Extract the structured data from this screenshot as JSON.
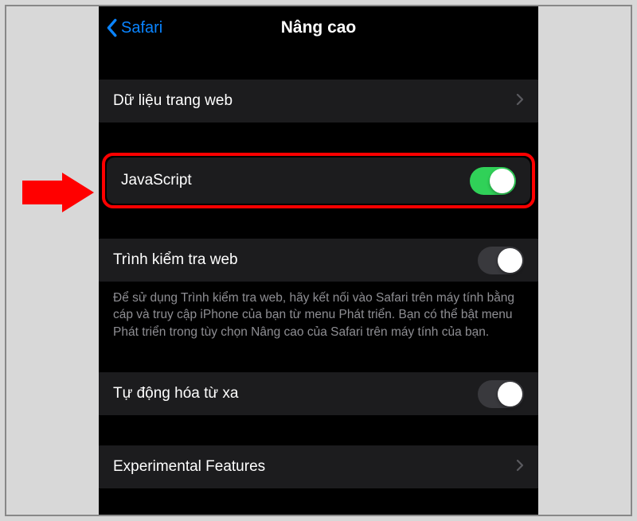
{
  "nav": {
    "back_label": "Safari",
    "title": "Nâng cao"
  },
  "rows": {
    "website_data": "Dữ liệu trang web",
    "javascript": "JavaScript",
    "web_inspector": "Trình kiểm tra web",
    "remote_automation": "Tự động hóa từ xa",
    "experimental_features": "Experimental Features"
  },
  "footer": {
    "web_inspector_help": "Để sử dụng Trình kiểm tra web, hãy kết nối vào Safari trên máy tính bằng cáp và truy cập iPhone của bạn từ menu Phát triển. Bạn có thể bật menu Phát triển trong tùy chọn Nâng cao của Safari trên máy tính của bạn."
  },
  "toggles": {
    "javascript": true,
    "web_inspector": false,
    "remote_automation": false
  }
}
